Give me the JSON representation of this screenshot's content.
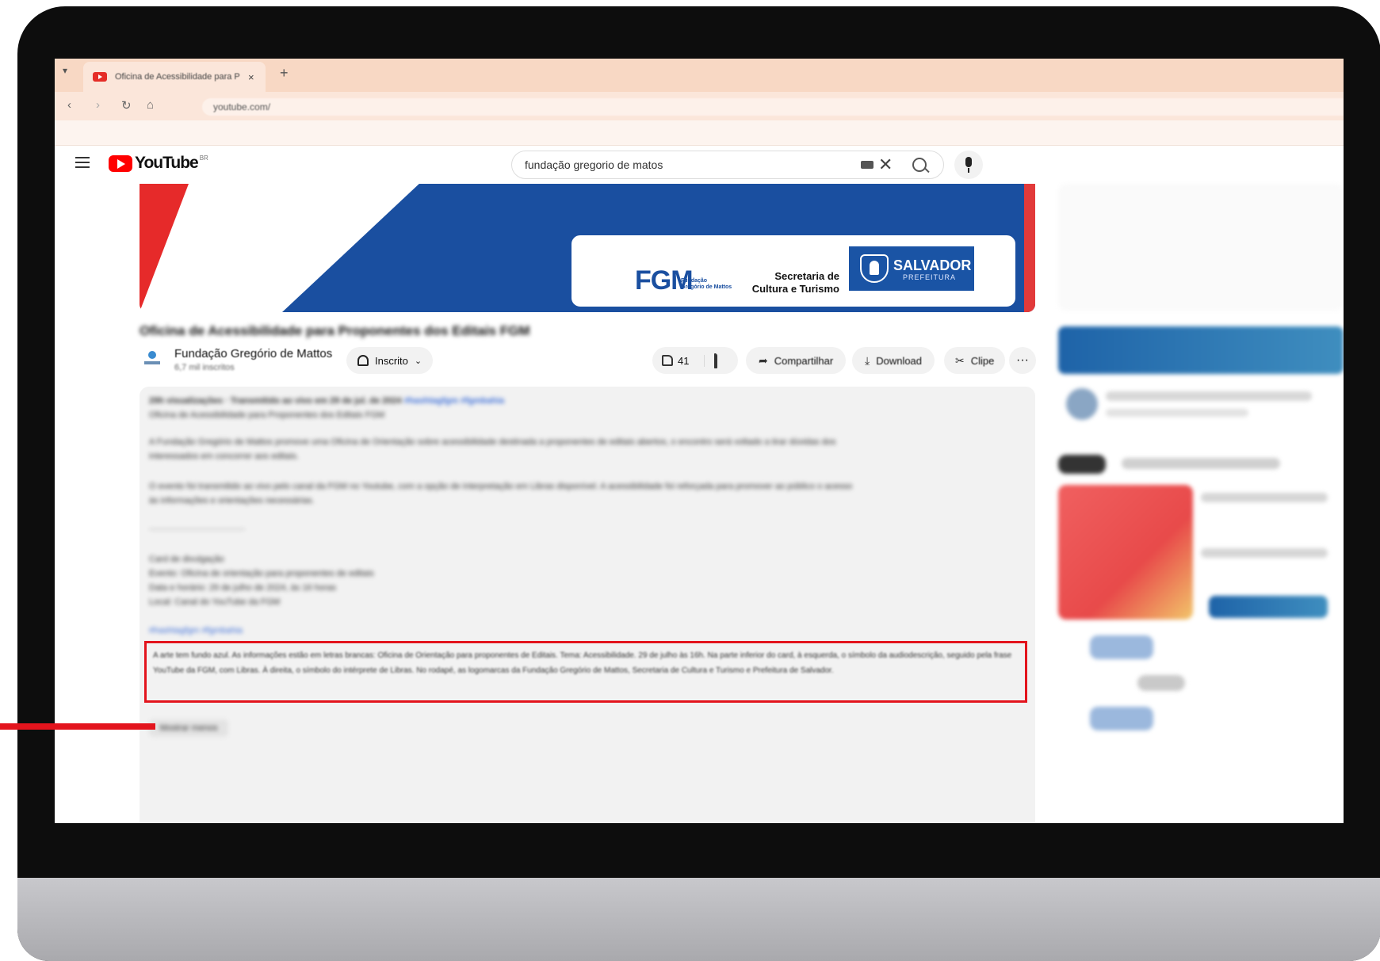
{
  "browser": {
    "tab_title": "Oficina de Acessibilidade para P",
    "tab_close": "×",
    "tab_new": "+",
    "tab_dropdown": "▾",
    "nav_back": "‹",
    "nav_forward": "›",
    "nav_reload": "↻",
    "nav_home": "⌂",
    "url_text": "youtube.com/"
  },
  "youtube": {
    "logo_text": "YouTube",
    "logo_sup": "BR",
    "search_value": "fundação gregorio de matos",
    "clear_glyph": "✕"
  },
  "banner": {
    "fgm_logo": "FGM",
    "fgm_sub_1": "Fundação",
    "fgm_sub_2": "Gregório de Mattos",
    "secretaria_1": "Secretaria de",
    "secretaria_2": "Cultura e Turismo",
    "salvador_name": "SALVADOR",
    "salvador_pref": "PREFEITURA"
  },
  "video": {
    "title": "Oficina de Acessibilidade para Proponentes dos Editais FGM",
    "channel_name": "Fundação Gregório de Mattos",
    "channel_subs": "6,7 mil inscritos",
    "subscribe_label": "Inscrito",
    "like_count": "41",
    "share_label": "Compartilhar",
    "download_label": "Download",
    "clip_label": "Clipe",
    "more_label": "···"
  },
  "description": {
    "line_1": "29h visualizações · Transmitido ao vivo em 29 de jul. de 2024",
    "line_1_tags": "#hashtagfgm #fgmbahia",
    "line_2": "Oficina de Acessibilidade para Proponentes dos Editais FGM",
    "line_3": "A Fundação Gregório de Mattos promove uma Oficina de Orientação sobre acessibilidade destinada a proponentes de editais abertos, o encontro será voltado a tirar dúvidas dos",
    "line_4": "interessados em concorrer aos editais.",
    "line_5": "O evento foi transmitido ao vivo pelo canal da FGM no Youtube, com a opção de interpretação em Libras disponível. A acessibilidade foi reforçada para promover ao público o acesso",
    "line_6": "às informações e orientações necessárias.",
    "line_7": "———————————",
    "line_8": "Card de divulgação",
    "line_9": "Evento: Oficina de orientação para proponentes de editais",
    "line_10": "Data e horário: 29 de julho de 2024, às 16 horas",
    "line_11": "Local: Canal do YouTube da FGM",
    "line_12": "#hashtagfgm #fgmbahia",
    "highlight_text": "A arte tem fundo azul. As informações estão em letras brancas: Oficina de Orientação para proponentes de Editais. Tema: Acessibilidade. 29 de julho às 16h. Na parte inferior do card, à esquerda, o símbolo da audiodescrição, seguido pela frase YouTube da FGM, com Libras. À direita, o símbolo do intérprete de Libras. No rodapé, as logomarcas da Fundação Gregório de Mattos, Secretaria de Cultura e Turismo e Prefeitura de Salvador.",
    "show_less": "Mostrar menos"
  }
}
